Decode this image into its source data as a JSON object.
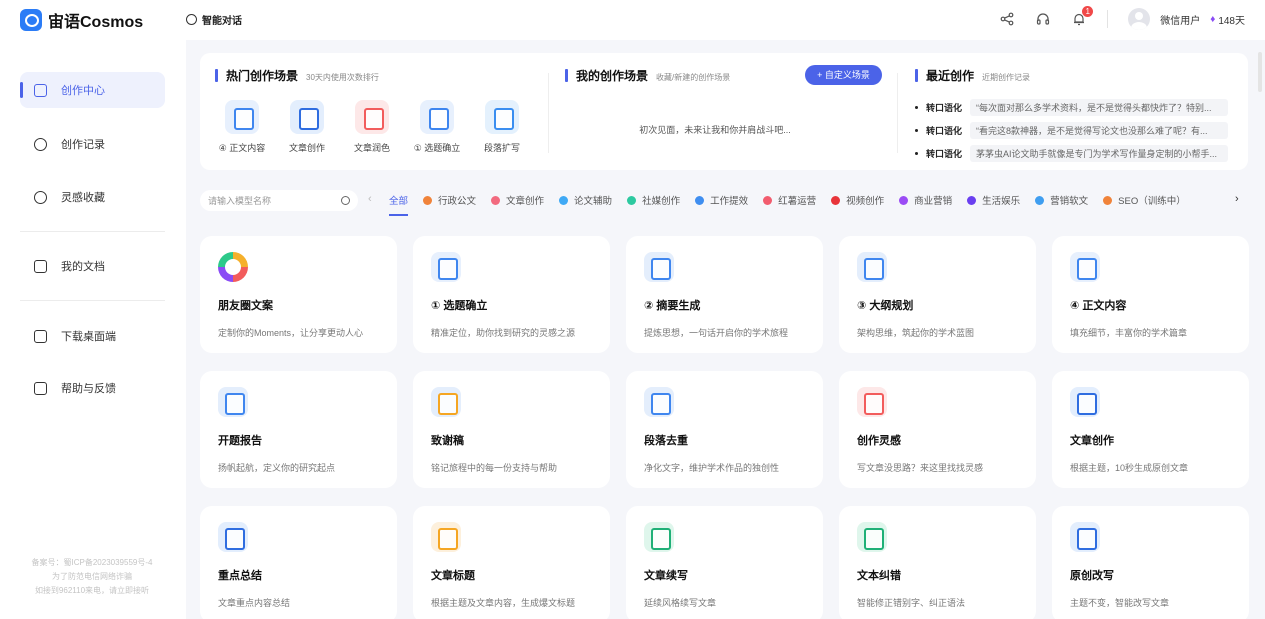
{
  "app": {
    "logo_text": "宙语Cosmos",
    "brand_color": "#2b7cf6",
    "accent_color": "#4b63e8"
  },
  "header": {
    "chat_tab": "智能对话",
    "notification_count": "1",
    "username": "微信用户",
    "vip_days": "148天",
    "icons": [
      "share-icon",
      "headset-icon",
      "bell-icon"
    ]
  },
  "sidebar": {
    "items": [
      {
        "label": "创作中心",
        "icon": "home-icon"
      },
      {
        "label": "创作记录",
        "icon": "cloud-icon"
      },
      {
        "label": "灵感收藏",
        "icon": "bulb-icon"
      },
      {
        "label": "我的文档",
        "icon": "book-icon"
      },
      {
        "label": "下载桌面端",
        "icon": "monitor-icon"
      },
      {
        "label": "帮助与反馈",
        "icon": "mail-icon"
      }
    ],
    "icp": [
      "备案号：蜀ICP备2023039559号-4",
      "为了防范电信网络诈骗",
      "如接到962110来电，请立即接听"
    ]
  },
  "hot": {
    "title": "热门创作场景",
    "subtitle": "30天内使用次数排行",
    "items": [
      {
        "label": "④ 正文内容",
        "icon": "document-icon",
        "color": "#3f86ef",
        "bg": "#e7f0fd"
      },
      {
        "label": "文章创作",
        "icon": "article-icon",
        "color": "#2f6de0",
        "bg": "#e3eefd"
      },
      {
        "label": "文章润色",
        "icon": "polish-icon",
        "color": "#f25c5c",
        "bg": "#fde8e8"
      },
      {
        "label": "① 选题确立",
        "icon": "checklist-icon",
        "color": "#3f86ef",
        "bg": "#e7f0fd"
      },
      {
        "label": "段落扩写",
        "icon": "expand-icon",
        "color": "#3a8ef0",
        "bg": "#e4f1fd"
      }
    ]
  },
  "mine": {
    "title": "我的创作场景",
    "subtitle": "收藏/新建的创作场景",
    "button": "+ 自定义场景",
    "empty": "初次见面，未来让我和你并肩战斗吧..."
  },
  "recent": {
    "title": "最近创作",
    "subtitle": "近期创作记录",
    "items": [
      {
        "tag": "转口语化",
        "text": "“每次面对那么多学术资料，是不是觉得头都快炸了？特别..."
      },
      {
        "tag": "转口语化",
        "text": "“看完这8款神器，是不是觉得写论文也没那么难了呢？有..."
      },
      {
        "tag": "转口语化",
        "text": "茅茅虫AI论文助手就像是专门为学术写作量身定制的小帮手..."
      }
    ]
  },
  "search": {
    "placeholder": "请输入模型名称"
  },
  "filters": [
    {
      "label": "全部",
      "color": ""
    },
    {
      "label": "行政公文",
      "color": "#f0833a"
    },
    {
      "label": "文章创作",
      "color": "#f26a7f"
    },
    {
      "label": "论文辅助",
      "color": "#3fa9f5"
    },
    {
      "label": "社媒创作",
      "color": "#2dc9a0"
    },
    {
      "label": "工作提效",
      "color": "#3f8ef0"
    },
    {
      "label": "红薯运营",
      "color": "#f25c6e"
    },
    {
      "label": "视频创作",
      "color": "#e8343a"
    },
    {
      "label": "商业营销",
      "color": "#9b4cf5"
    },
    {
      "label": "生活娱乐",
      "color": "#6a3ff0"
    },
    {
      "label": "营销软文",
      "color": "#3f9ef0"
    },
    {
      "label": "SEO（训练中）",
      "color": "#f0833a"
    }
  ],
  "cards": [
    {
      "title": "朋友圈文案",
      "desc": "定制你的Moments，让分享更动人心",
      "icon": "ring-icon",
      "color": "#f5b02c",
      "bg": "#ffffff"
    },
    {
      "title": "① 选题确立",
      "desc": "精准定位，助你找到研究的灵感之源",
      "icon": "checklist-icon",
      "color": "#3f86ef",
      "bg": "#e7f0fd"
    },
    {
      "title": "② 摘要生成",
      "desc": "提炼思想，一句话开启你的学术旅程",
      "icon": "summary-icon",
      "color": "#3f86ef",
      "bg": "#e4eefc"
    },
    {
      "title": "③ 大纲规划",
      "desc": "架构思维，筑起你的学术蓝图",
      "icon": "outline-icon",
      "color": "#3f86ef",
      "bg": "#e4eefc"
    },
    {
      "title": "④ 正文内容",
      "desc": "填充细节，丰富你的学术篇章",
      "icon": "document-icon",
      "color": "#3f86ef",
      "bg": "#e7f0fd"
    },
    {
      "title": "开题报告",
      "desc": "扬帆起航，定义你的研究起点",
      "icon": "report-icon",
      "color": "#3f86ef",
      "bg": "#e4eefc"
    },
    {
      "title": "致谢稿",
      "desc": "铭记旅程中的每一份支持与帮助",
      "icon": "thanks-icon",
      "color": "#f5a623",
      "bg": "#e4eefc"
    },
    {
      "title": "段落去重",
      "desc": "净化文字，维护学术作品的独创性",
      "icon": "dedupe-icon",
      "color": "#3f86ef",
      "bg": "#e4eefc"
    },
    {
      "title": "创作灵感",
      "desc": "写文章没思路？来这里找找灵感",
      "icon": "inspiration-icon",
      "color": "#f25c5c",
      "bg": "#fde8e8"
    },
    {
      "title": "文章创作",
      "desc": "根据主题，10秒生成原创文章",
      "icon": "article-icon",
      "color": "#2f6de0",
      "bg": "#e3eefd"
    },
    {
      "title": "重点总结",
      "desc": "文章重点内容总结",
      "icon": "highlight-icon",
      "color": "#2f6de0",
      "bg": "#e3eefd"
    },
    {
      "title": "文章标题",
      "desc": "根据主题及文章内容，生成爆文标题",
      "icon": "title-icon",
      "color": "#f5a623",
      "bg": "#fdf0dc"
    },
    {
      "title": "文章续写",
      "desc": "延续风格续写文章",
      "icon": "continue-icon",
      "color": "#1fb077",
      "bg": "#dff6ec"
    },
    {
      "title": "文本纠错",
      "desc": "智能修正错别字、纠正语法",
      "icon": "correct-icon",
      "color": "#1fb077",
      "bg": "#dff6ec"
    },
    {
      "title": "原创改写",
      "desc": "主题不变，智能改写文章",
      "icon": "rewrite-icon",
      "color": "#2f6de0",
      "bg": "#e3eefd"
    }
  ]
}
